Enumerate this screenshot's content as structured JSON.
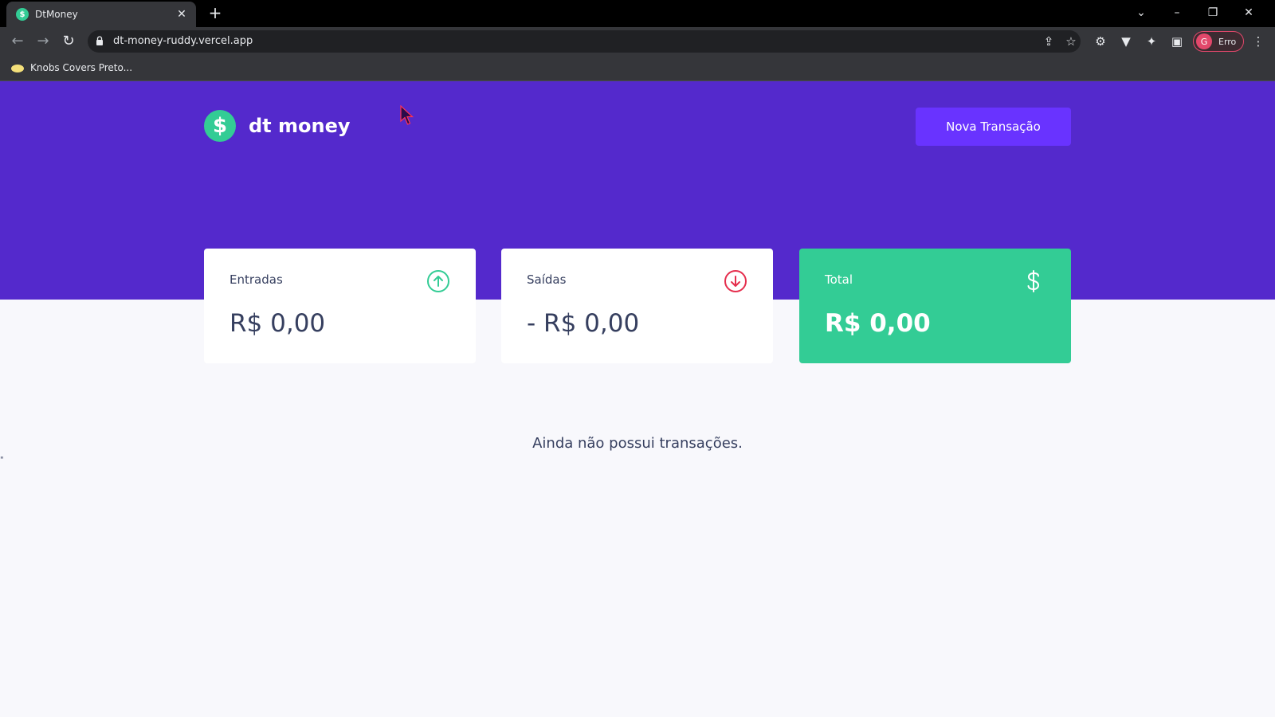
{
  "browser": {
    "tab_title": "DtMoney",
    "tab_favicon": "$",
    "url": "dt-money-ruddy.vercel.app",
    "bookmark": "Knobs Covers Preto...",
    "profile_initial": "G",
    "profile_label": "Erro",
    "icons": [
      "back-icon",
      "forward-icon",
      "reload-icon",
      "lock-icon",
      "share-icon",
      "star-icon",
      "settings-icon",
      "extension-v-icon",
      "puzzle-icon",
      "sidepanel-icon",
      "menu-icon"
    ]
  },
  "header": {
    "logo_symbol": "$",
    "logo_text": "dt money",
    "new_transaction_label": "Nova Transação"
  },
  "summary": {
    "income": {
      "label": "Entradas",
      "value": "R$ 0,00",
      "icon": "arrow-up-circle-icon",
      "color": "#33cc95"
    },
    "outcome": {
      "label": "Saídas",
      "value": "- R$ 0,00",
      "icon": "arrow-down-circle-icon",
      "color": "#e52e4d"
    },
    "total": {
      "label": "Total",
      "value": "R$ 0,00",
      "icon": "dollar-icon",
      "color": "#ffffff"
    }
  },
  "transactions": {
    "empty_message": "Ainda não possui transações."
  },
  "stray_mark": "\""
}
